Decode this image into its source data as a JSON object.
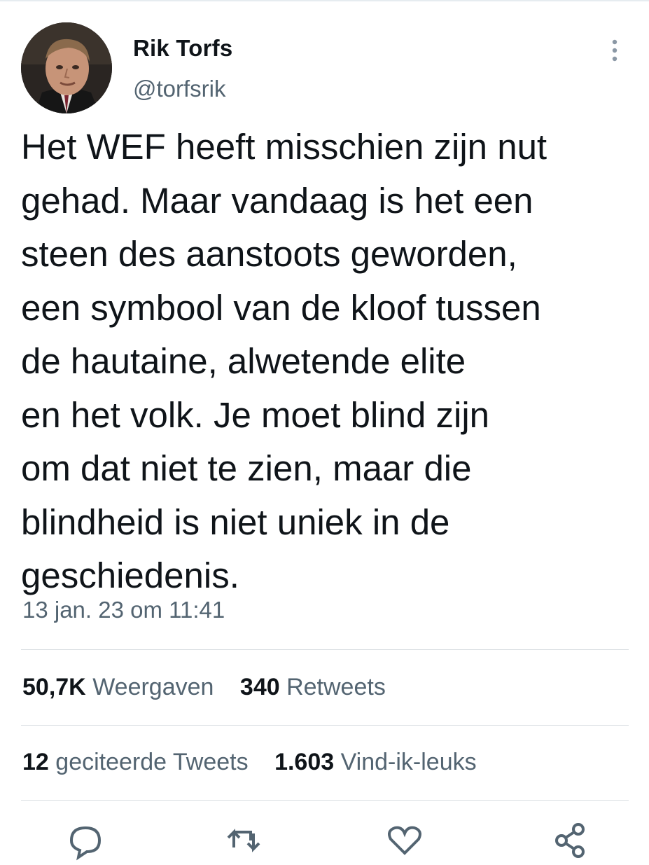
{
  "author": {
    "name": "Rik Torfs",
    "handle": "@torfsrik"
  },
  "tweet": {
    "lines": [
      "Het WEF heeft misschien zijn nut",
      "gehad. Maar vandaag is het een",
      "steen des aanstoots geworden,",
      "een symbool van de kloof tussen",
      "de hautaine, alwetende elite",
      "en het volk. Je moet blind zijn",
      "om dat niet te zien, maar die",
      "blindheid is niet uniek in de",
      "geschiedenis."
    ],
    "timestamp": "13 jan. 23 om 11:41"
  },
  "stats": {
    "views": {
      "count": "50,7K",
      "label": "Weergaven"
    },
    "retweets": {
      "count": "340",
      "label": "Retweets"
    },
    "quotes": {
      "count": "12",
      "label": "geciteerde Tweets"
    },
    "likes": {
      "count": "1.603",
      "label": "Vind-ik-leuks"
    }
  },
  "icons": {
    "more": "more-vertical-icon",
    "actions": [
      "reply-icon",
      "retweet-icon",
      "like-icon",
      "share-icon"
    ]
  },
  "colors": {
    "text_primary": "#0f1419",
    "text_secondary": "#536471",
    "divider": "#d9dee2"
  }
}
